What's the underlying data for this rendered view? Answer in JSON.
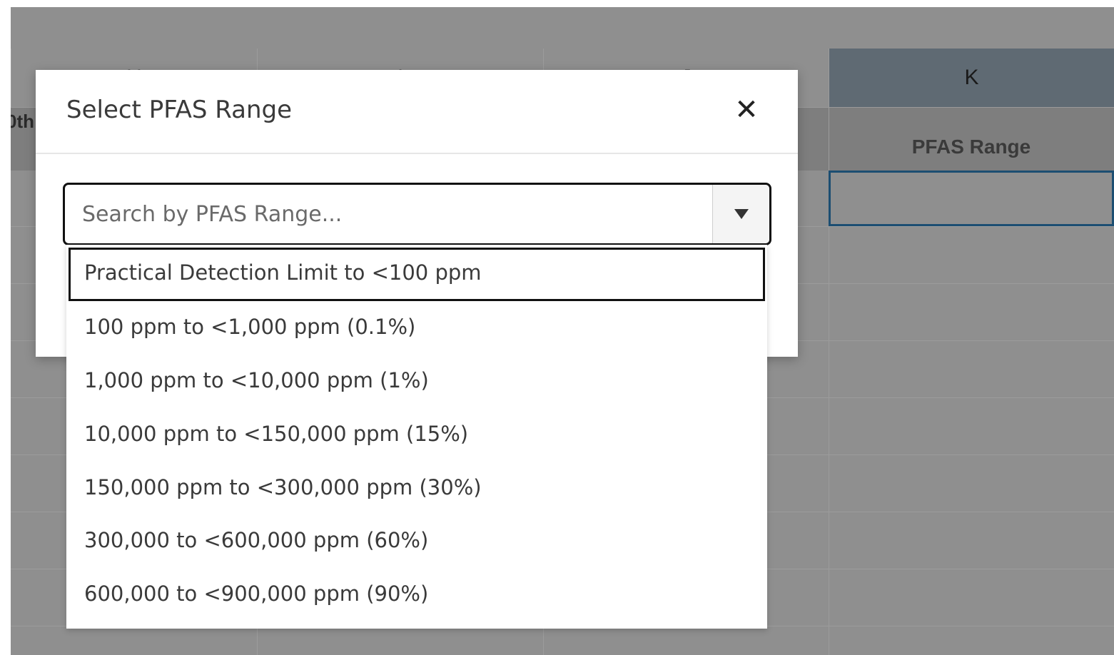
{
  "spreadsheet": {
    "columns": [
      {
        "letter": "H"
      },
      {
        "letter": "I"
      },
      {
        "letter": "J"
      },
      {
        "letter": "K",
        "selected": true
      }
    ],
    "left_clipped_header": "0th",
    "visible_header": "PFAS Range"
  },
  "modal": {
    "title": "Select PFAS Range",
    "close_glyph": "✕",
    "search": {
      "placeholder": "Search by PFAS Range...",
      "value": ""
    },
    "options": [
      "Practical Detection Limit to <100 ppm",
      "100 ppm to <1,000 ppm (0.1%)",
      "1,000 ppm to <10,000 ppm (1%)",
      "10,000 ppm to <150,000 ppm (15%)",
      "150,000 ppm to <300,000 ppm (30%)",
      "300,000 to <600,000 ppm (60%)",
      "600,000 to <900,000 ppm (90%)"
    ],
    "focused_option_index": 0
  },
  "colors": {
    "overlay": "#8f8f8f",
    "selected_column_header": "#5f6a73",
    "active_cell_border": "#1c4e72"
  }
}
